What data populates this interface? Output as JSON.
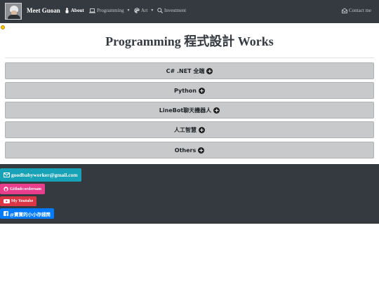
{
  "navbar": {
    "brand": "Meet Guoan",
    "items": [
      {
        "label": "About",
        "icon": "person-icon",
        "active": true
      },
      {
        "label": "Programming",
        "icon": "laptop-icon",
        "caret": "▼"
      },
      {
        "label": "Art",
        "icon": "palette-icon",
        "caret": "▼"
      },
      {
        "label": "Investment",
        "icon": "search-dollar-icon"
      }
    ],
    "contact": {
      "label": "Contact me",
      "icon": "envelope-open-icon"
    }
  },
  "main": {
    "title": "Programming 程式設計 Works",
    "sections": [
      {
        "label": "C# .NET 全端"
      },
      {
        "label": "Python"
      },
      {
        "label": "LineBot聊天機器人"
      },
      {
        "label": "人工智慧"
      },
      {
        "label": "Others"
      }
    ],
    "plus_symbol": "+"
  },
  "footer": {
    "email": "goodbabyworker@gmail.com",
    "github": "Github:ordersam",
    "youtube": "My Youtube",
    "facebook": "@寶寶的小小存錢筒"
  },
  "colors": {
    "navbar_bg": "#343a40",
    "accordion_bg": "#c8c9ca",
    "email_btn": "#17a2b8",
    "github_btn": "#e83e8c",
    "youtube_btn": "#dc3545",
    "facebook_btn": "#007bff"
  }
}
